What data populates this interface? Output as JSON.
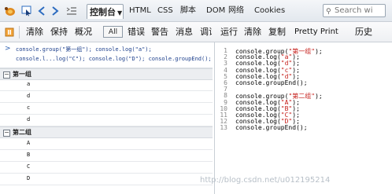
{
  "toolbar": {
    "active_tab": "控制台",
    "tabs": [
      "HTML",
      "CSS",
      "脚本",
      "DOM",
      "网络",
      "Cookies"
    ],
    "search_placeholder": "Search wi"
  },
  "console_toolbar": {
    "items_left": [
      "清除",
      "保持",
      "概况"
    ],
    "filter_all": "All",
    "filters": [
      "错误",
      "警告",
      "消息",
      "调试信息"
    ],
    "items_right": [
      "运行",
      "清除",
      "复制",
      "Pretty Print",
      "历史"
    ]
  },
  "console": {
    "prompt": ">",
    "command_lines": [
      "console.group(\"第一组\"); console.log(\"a\");",
      "console.l...log(\"C\"); console.log(\"D\"); console.groupEnd();"
    ],
    "groups": [
      {
        "name": "第一组",
        "items": [
          "a",
          "d",
          "c",
          "d"
        ]
      },
      {
        "name": "第二组",
        "items": [
          "A",
          "B",
          "C",
          "D"
        ]
      }
    ]
  },
  "editor": {
    "lines": [
      {
        "n": "1",
        "pre": "console.group(",
        "str": "\"第一组\"",
        "post": ");"
      },
      {
        "n": "2",
        "pre": "console.log(",
        "str": "\"a\"",
        "post": ");"
      },
      {
        "n": "3",
        "pre": "console.log(",
        "str": "\"d\"",
        "post": ");"
      },
      {
        "n": "4",
        "pre": "console.log(",
        "str": "\"c\"",
        "post": ");"
      },
      {
        "n": "5",
        "pre": "console.log(",
        "str": "\"d\"",
        "post": ");"
      },
      {
        "n": "6",
        "pre": "console.groupEnd();",
        "str": "",
        "post": ""
      },
      {
        "n": "7",
        "pre": "",
        "str": "",
        "post": ""
      },
      {
        "n": "8",
        "pre": "console.group(",
        "str": "\"第二组\"",
        "post": ");"
      },
      {
        "n": "9",
        "pre": "console.log(",
        "str": "\"A\"",
        "post": ");"
      },
      {
        "n": "10",
        "pre": "console.log(",
        "str": "\"B\"",
        "post": ");"
      },
      {
        "n": "11",
        "pre": "console.log(",
        "str": "\"C\"",
        "post": ");"
      },
      {
        "n": "12",
        "pre": "console.log(",
        "str": "\"D\"",
        "post": ");"
      },
      {
        "n": "13",
        "pre": "console.groupEnd();",
        "str": "",
        "post": ""
      }
    ]
  },
  "watermark": "http://blog.csdn.net/u012195214"
}
